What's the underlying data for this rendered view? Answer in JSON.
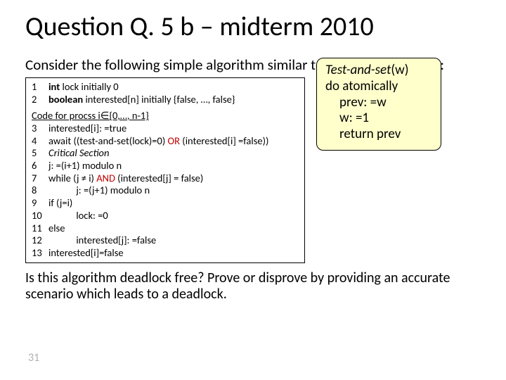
{
  "title": "Question Q. 5 b – midterm 2010",
  "intro": "Consider the following simple algorithm similar to that shown in class:",
  "side": {
    "title_i": "Test-and-set",
    "title_arg": "(w)",
    "l1": "do atomically",
    "l2": "prev: =w",
    "l3": "w: =1",
    "l4": "return prev"
  },
  "decl": [
    {
      "n": "1",
      "kw": "int",
      "rest": " lock initially 0"
    },
    {
      "n": "2",
      "kw": "boolean",
      "rest": " interested[n] initially {false, …, false}"
    }
  ],
  "proc_header": "Code for procss i∈{0,…, n-1}",
  "lines": {
    "l3": {
      "n": "3",
      "t": "interested[i]: =true"
    },
    "l4": {
      "n": "4",
      "pre": "await ((test-and-set(lock)=0) ",
      "or": "OR",
      "post": " (interested[i] =false))"
    },
    "l5": {
      "n": "5",
      "t": "Critical Section"
    },
    "l6": {
      "n": "6",
      "t": "j: =(i+1) modulo n"
    },
    "l7": {
      "n": "7",
      "pre": "while (j ≠ i) ",
      "and": "AND",
      "post": " (interested[j] = false)"
    },
    "l8": {
      "n": "8",
      "t": "            j: =(j+1) modulo n"
    },
    "l9": {
      "n": "9",
      "t": "if (j=i)"
    },
    "l10": {
      "n": "10",
      "t": "            lock: =0"
    },
    "l11": {
      "n": "11",
      "t": "else"
    },
    "l12": {
      "n": "12",
      "t": "            interested[j]: =false"
    },
    "l13": {
      "n": "13",
      "t": "interested[i]=false"
    }
  },
  "closing": "Is this algorithm deadlock free? Prove or disprove by providing an accurate scenario which leads to a deadlock.",
  "page": "31"
}
